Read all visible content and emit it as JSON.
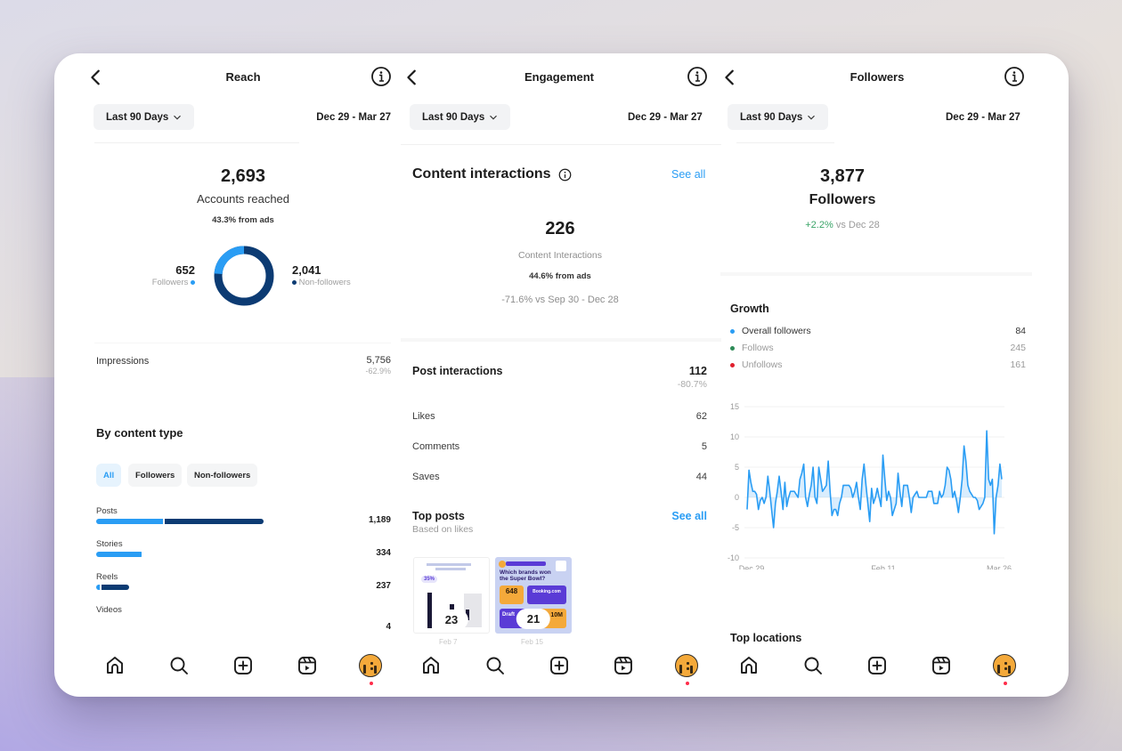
{
  "panels": {
    "reach": {
      "title": "Reach",
      "range_button": "Last 90 Days",
      "date_range": "Dec 29 - Mar 27",
      "total": "2,693",
      "total_label": "Accounts reached",
      "ads_note": "43.3% from ads",
      "donut": {
        "followers": {
          "value": "652",
          "label": "Followers",
          "count": 652,
          "color": "#2a9df4"
        },
        "non_followers": {
          "value": "2,041",
          "label": "Non-followers",
          "count": 2041,
          "color": "#0c3b73"
        }
      },
      "impressions": {
        "label": "Impressions",
        "value": "5,756",
        "change": "-62.9%"
      },
      "by_content_type": {
        "title": "By content type",
        "chips": [
          "All",
          "Followers",
          "Non-followers"
        ],
        "active_chip": "All",
        "rows": [
          {
            "label": "Posts",
            "value": "1,189",
            "total": 1189,
            "followers_share": 0.4
          },
          {
            "label": "Stories",
            "value": "334",
            "total": 334,
            "followers_share": 0.98
          },
          {
            "label": "Reels",
            "value": "237",
            "total": 237,
            "followers_share": 0.12
          },
          {
            "label": "Videos",
            "value": "4",
            "total": 4,
            "followers_share": 0
          }
        ]
      }
    },
    "engagement": {
      "title": "Engagement",
      "range_button": "Last 90 Days",
      "date_range": "Dec 29 - Mar 27",
      "content_interactions": {
        "title": "Content interactions",
        "see_all": "See all",
        "total": "226",
        "total_label": "Content Interactions",
        "ads_note": "44.6% from ads",
        "comparison": "-71.6% vs Sep 30 - Dec 28"
      },
      "post_interactions": {
        "title": "Post interactions",
        "value": "112",
        "change": "-80.7%",
        "rows": [
          {
            "label": "Likes",
            "value": "62"
          },
          {
            "label": "Comments",
            "value": "5"
          },
          {
            "label": "Saves",
            "value": "44"
          }
        ]
      },
      "top_posts": {
        "title": "Top posts",
        "subtitle": "Based on likes",
        "see_all": "See all",
        "posts": [
          {
            "count": "23",
            "date": "Feb 7",
            "thumb_text": "35%"
          },
          {
            "count": "21",
            "date": "Feb 15",
            "thumb_headline": "Which brands won the Super Bowl?",
            "thumb_stat": "648",
            "thumb_brand": "Booking.com",
            "thumb_brand2": "Draft",
            "thumb_stat2": "10M"
          }
        ]
      }
    },
    "followers": {
      "title": "Followers",
      "range_button": "Last 90 Days",
      "date_range": "Dec 29 - Mar 27",
      "total": "3,877",
      "total_label": "Followers",
      "change_positive": "+2.2%",
      "change_suffix": "vs Dec 28",
      "growth": {
        "title": "Growth",
        "legend": [
          {
            "label": "Overall followers",
            "value": "84",
            "color": "#2a9df4"
          },
          {
            "label": "Follows",
            "value": "245",
            "color": "#2e8b57"
          },
          {
            "label": "Unfollows",
            "value": "161",
            "color": "#e0202e"
          }
        ]
      },
      "top_locations_title": "Top locations"
    }
  },
  "bottom_nav": [
    "home-icon",
    "search-icon",
    "create-icon",
    "reels-icon",
    "profile-avatar"
  ],
  "chart_data": {
    "type": "area",
    "title": "Growth",
    "xlabel": "",
    "ylabel": "",
    "ylim": [
      -10,
      15
    ],
    "yticks": [
      "15",
      "10",
      "5",
      "0",
      "-5",
      "-10"
    ],
    "xticks": [
      "Dec 29",
      "Feb 11",
      "Mar 26"
    ],
    "grid": true,
    "series": [
      {
        "name": "Overall followers",
        "color": "#2a9df4",
        "values": [
          -2,
          4.5,
          2.5,
          1,
          1,
          0.5,
          -2,
          -0.5,
          0,
          -1,
          0,
          3.5,
          1,
          -2,
          -5,
          -1,
          1,
          3.5,
          1,
          -2,
          2.5,
          -1.5,
          0,
          1,
          1,
          1,
          0.5,
          0,
          3,
          4,
          5.5,
          0,
          -1.5,
          0.5,
          2,
          5,
          0,
          -1,
          5,
          3,
          1,
          1.5,
          2,
          6,
          1,
          -3,
          -2,
          -2,
          -3,
          -1,
          0,
          2,
          2,
          2,
          2,
          1.5,
          0,
          1,
          2.5,
          0,
          -2,
          3,
          5.5,
          2,
          -1,
          -4,
          1.5,
          -1,
          0,
          1.5,
          0,
          -1.5,
          7,
          3,
          -0.5,
          1,
          0,
          -3,
          -2,
          -1,
          4,
          1,
          -1.5,
          2,
          2,
          2,
          0,
          -2.5,
          0,
          0.5,
          1,
          0,
          0,
          0,
          0,
          0,
          1,
          1,
          1,
          -1,
          -1,
          -1,
          1,
          0,
          0.5,
          2,
          5,
          4.5,
          3,
          0,
          1,
          -0.5,
          -2.5,
          0,
          3,
          8.5,
          6,
          2,
          1,
          0.5,
          0,
          0,
          -0.5,
          -2,
          -1.5,
          -1,
          0,
          11,
          3,
          2,
          3,
          -6,
          0,
          2,
          5.5,
          3
        ]
      }
    ]
  }
}
